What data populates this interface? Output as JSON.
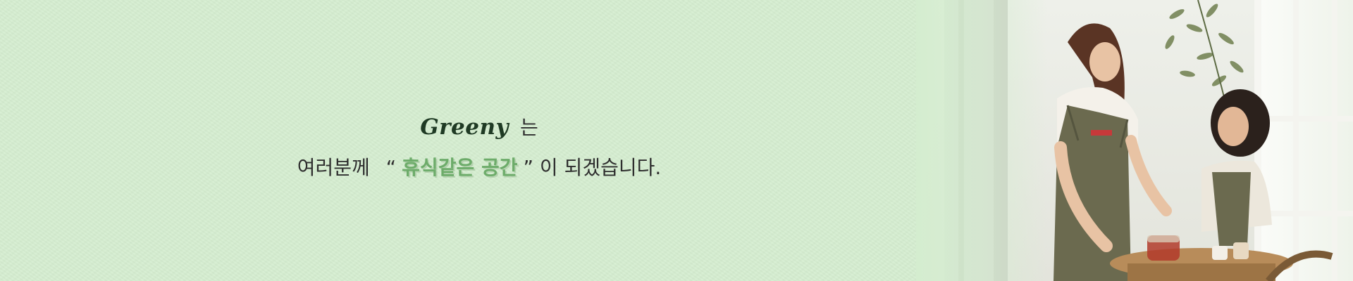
{
  "banner": {
    "brand": "Greeny",
    "brand_particle": "는",
    "line_prefix": "여러분께",
    "quote_open": "“",
    "highlight": "휴식같은 공간",
    "quote_close": "”",
    "line_suffix": "이 되겠습니다."
  },
  "colors": {
    "background": "#d4edcf",
    "brand_text": "#1f3a24",
    "highlight_text": "#6dac6a",
    "body_text": "#2e2e2e"
  }
}
